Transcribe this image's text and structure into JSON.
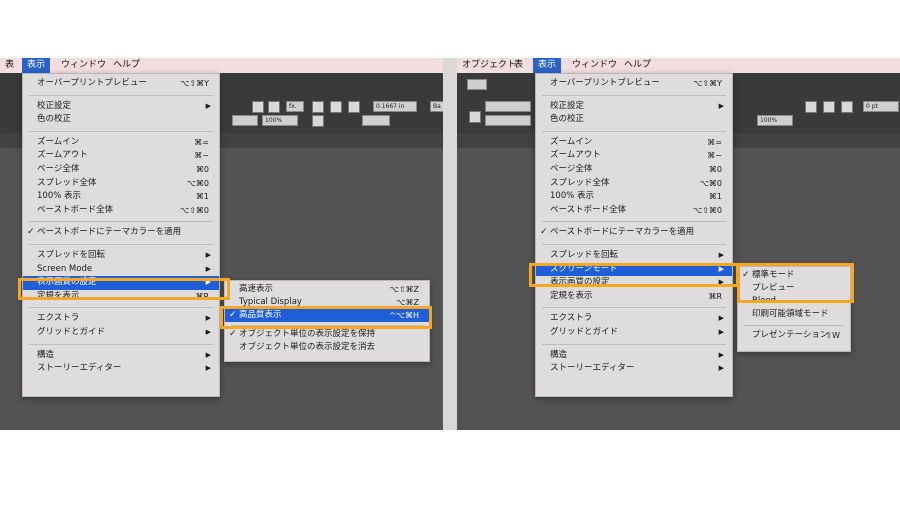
{
  "left": {
    "menubar": [
      "表",
      "表示",
      "ウィンドウ",
      "ヘルプ"
    ],
    "toolbar": {
      "field_value": "0.1667 in",
      "zoom": "100%",
      "font_box": "Ba"
    },
    "menu": [
      {
        "label": "オーバープリントプレビュー",
        "shortcut": "⌥⇧⌘Y"
      },
      {
        "sep": true
      },
      {
        "label": "校正設定",
        "arrow": "▶"
      },
      {
        "label": "色の校正"
      },
      {
        "sep": true
      },
      {
        "label": "ズームイン",
        "shortcut": "⌘="
      },
      {
        "label": "ズームアウト",
        "shortcut": "⌘−"
      },
      {
        "label": "ページ全体",
        "shortcut": "⌘0"
      },
      {
        "label": "スプレッド全体",
        "shortcut": "⌥⌘0"
      },
      {
        "label": "100% 表示",
        "shortcut": "⌘1"
      },
      {
        "label": "ペーストボード全体",
        "shortcut": "⌥⇧⌘0"
      },
      {
        "sep": true
      },
      {
        "label": "ペーストボードにテーマカラーを適用",
        "check": "✓"
      },
      {
        "sep": true
      },
      {
        "label": "スプレッドを回転",
        "arrow": "▶"
      },
      {
        "label": "Screen Mode",
        "arrow": "▶"
      },
      {
        "label": "表示画質の設定",
        "arrow": "▶",
        "highlight": true
      },
      {
        "label": "定規を表示",
        "shortcut": "⌘R"
      },
      {
        "sep": true
      },
      {
        "label": "エクストラ",
        "arrow": "▶"
      },
      {
        "label": "グリッドとガイド",
        "arrow": "▶"
      },
      {
        "sep": true
      },
      {
        "label": "構造",
        "arrow": "▶"
      },
      {
        "label": "ストーリーエディター",
        "arrow": "▶"
      }
    ],
    "submenu": [
      {
        "label": "高速表示",
        "shortcut": "⌥⇧⌘Z"
      },
      {
        "label": "Typical Display",
        "shortcut": "⌥⌘Z"
      },
      {
        "label": "高品質表示",
        "shortcut": "^⌥⌘H",
        "check": "✓",
        "highlight": true
      },
      {
        "sep": true
      },
      {
        "label": "オブジェクト単位の表示設定を保持",
        "check": "✓"
      },
      {
        "label": "オブジェクト単位の表示設定を消去"
      }
    ]
  },
  "right": {
    "menubar": [
      "オブジェクト",
      "表",
      "表示",
      "ウィンドウ",
      "ヘルプ"
    ],
    "toolbar": {
      "zoom": "100%",
      "value": "0 pt"
    },
    "menu": [
      {
        "label": "オーバープリントプレビュー",
        "shortcut": "⌥⇧⌘Y"
      },
      {
        "sep": true
      },
      {
        "label": "校正設定",
        "arrow": "▶"
      },
      {
        "label": "色の校正"
      },
      {
        "sep": true
      },
      {
        "label": "ズームイン",
        "shortcut": "⌘="
      },
      {
        "label": "ズームアウト",
        "shortcut": "⌘−"
      },
      {
        "label": "ページ全体",
        "shortcut": "⌘0"
      },
      {
        "label": "スプレッド全体",
        "shortcut": "⌥⌘0"
      },
      {
        "label": "100% 表示",
        "shortcut": "⌘1"
      },
      {
        "label": "ペーストボード全体",
        "shortcut": "⌥⇧⌘0"
      },
      {
        "sep": true
      },
      {
        "label": "ペーストボードにテーマカラーを適用",
        "check": "✓"
      },
      {
        "sep": true
      },
      {
        "label": "スプレッドを回転",
        "arrow": "▶"
      },
      {
        "label": "スクリーンモード",
        "arrow": "▶",
        "highlight": true
      },
      {
        "label": "表示画質の設定",
        "arrow": "▶"
      },
      {
        "label": "定規を表示",
        "shortcut": "⌘R"
      },
      {
        "sep": true
      },
      {
        "label": "エクストラ",
        "arrow": "▶"
      },
      {
        "label": "グリッドとガイド",
        "arrow": "▶"
      },
      {
        "sep": true
      },
      {
        "label": "構造",
        "arrow": "▶"
      },
      {
        "label": "ストーリーエディター",
        "arrow": "▶"
      }
    ],
    "submenu": [
      {
        "label": "標準モード",
        "check": "✓"
      },
      {
        "label": "プレビュー"
      },
      {
        "label": "Bleed"
      },
      {
        "label": "印刷可能領域モード"
      },
      {
        "sep": true
      },
      {
        "label": "プレゼンテーション",
        "shortcut": "⇧W"
      }
    ]
  },
  "colors": {
    "highlight": "#1f5ed6",
    "callout": "#f5a623",
    "menubar": "#f2dde0",
    "canvas": "#535353"
  }
}
